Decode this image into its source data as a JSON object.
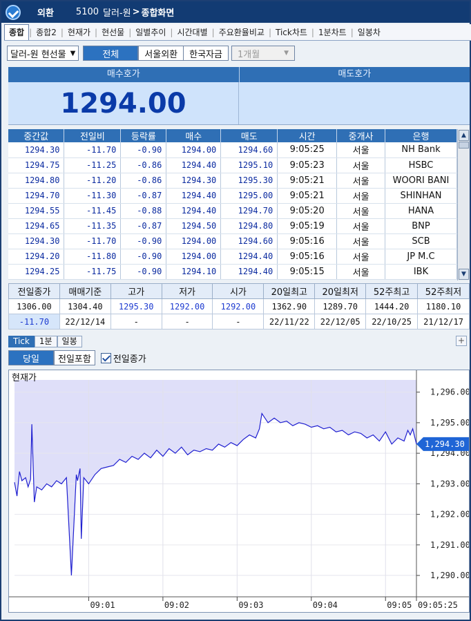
{
  "window": {
    "badge": "외환",
    "code": "5100",
    "name_prefix": "달러-원",
    "name_suffix": "종합화면"
  },
  "top_tabs": [
    "종합",
    "종합2",
    "현재가",
    "현선물",
    "일별추이",
    "시간대별",
    "주요환율비교",
    "Tick차트",
    "1분차트",
    "일봉차"
  ],
  "toolbar": {
    "instrument": "달러-원 현선물",
    "filters": [
      "전체",
      "서울외환",
      "한국자금"
    ],
    "period": "1개월"
  },
  "quote": {
    "bid_label": "매수호가",
    "ask_label": "매도호가",
    "bid_value": "1294.00",
    "ask_value": ""
  },
  "ticks": {
    "headers": [
      "중간값",
      "전일비",
      "등락률",
      "매수",
      "매도",
      "시간",
      "중개사",
      "은행"
    ],
    "rows": [
      [
        "1294.30",
        "-11.70",
        "-0.90",
        "1294.00",
        "1294.60",
        "9:05:25",
        "서울",
        "NH Bank"
      ],
      [
        "1294.75",
        "-11.25",
        "-0.86",
        "1294.40",
        "1295.10",
        "9:05:23",
        "서울",
        "HSBC"
      ],
      [
        "1294.80",
        "-11.20",
        "-0.86",
        "1294.30",
        "1295.30",
        "9:05:21",
        "서울",
        "WOORI BANI"
      ],
      [
        "1294.70",
        "-11.30",
        "-0.87",
        "1294.40",
        "1295.00",
        "9:05:21",
        "서울",
        "SHINHAN"
      ],
      [
        "1294.55",
        "-11.45",
        "-0.88",
        "1294.40",
        "1294.70",
        "9:05:20",
        "서울",
        "HANA"
      ],
      [
        "1294.65",
        "-11.35",
        "-0.87",
        "1294.50",
        "1294.80",
        "9:05:19",
        "서울",
        "BNP"
      ],
      [
        "1294.30",
        "-11.70",
        "-0.90",
        "1294.00",
        "1294.60",
        "9:05:16",
        "서울",
        "SCB"
      ],
      [
        "1294.20",
        "-11.80",
        "-0.90",
        "1294.00",
        "1294.40",
        "9:05:16",
        "서울",
        "JP M.C"
      ],
      [
        "1294.25",
        "-11.75",
        "-0.90",
        "1294.10",
        "1294.40",
        "9:05:15",
        "서울",
        "IBK"
      ]
    ]
  },
  "summary": {
    "headers": [
      "전일종가",
      "매매기준",
      "고가",
      "저가",
      "시가",
      "20일최고",
      "20일최저",
      "52주최고",
      "52주최저"
    ],
    "row1": [
      "1306.00",
      "1304.40",
      "1295.30",
      "1292.00",
      "1292.00",
      "1362.90",
      "1289.70",
      "1444.20",
      "1180.10"
    ],
    "row2": [
      "-11.70",
      "22/12/14",
      "-",
      "-",
      "-",
      "22/11/22",
      "22/12/05",
      "22/10/25",
      "21/12/17"
    ]
  },
  "chart_tabs": [
    "Tick",
    "1분",
    "일봉"
  ],
  "chart_controls": {
    "today": "당일",
    "include_prev": "전일포함",
    "prev_close_checkbox": "전일종가"
  },
  "chart_data": {
    "type": "line",
    "title": "현재가",
    "y_ticks": [
      "1,296.00",
      "1,295.00",
      "1,294.00",
      "1,293.00",
      "1,292.00",
      "1,291.00",
      "1,290.00"
    ],
    "y_tick_values": [
      1296,
      1295,
      1294,
      1293,
      1292,
      1291,
      1290
    ],
    "ylim": [
      1289.3,
      1296.4
    ],
    "x_ticks": [
      "09:01",
      "09:02",
      "09:03",
      "09:04",
      "09:05",
      "09:05:25"
    ],
    "x_tick_values": [
      60,
      120,
      180,
      240,
      300,
      325
    ],
    "xlim": [
      0,
      325
    ],
    "current_value": "1,294.30",
    "series": [
      {
        "x": [
          0,
          2,
          4,
          6,
          9,
          11,
          13,
          14,
          16,
          18,
          22,
          26,
          30,
          34,
          38,
          42,
          46,
          50,
          51,
          53,
          54,
          56,
          60,
          65,
          70,
          75,
          80,
          85,
          90,
          95,
          100,
          105,
          110,
          115,
          120,
          125,
          130,
          135,
          140,
          145,
          150,
          155,
          160,
          165,
          170,
          175,
          180,
          185,
          190,
          195,
          198,
          200,
          205,
          210,
          215,
          220,
          225,
          230,
          235,
          240,
          245,
          250,
          255,
          260,
          265,
          270,
          275,
          280,
          285,
          290,
          295,
          300,
          305,
          310,
          315,
          318,
          320,
          322,
          325
        ],
        "y": [
          1293.05,
          1292.6,
          1293.4,
          1293.1,
          1293.2,
          1292.9,
          1293.15,
          1294.95,
          1292.4,
          1292.9,
          1292.8,
          1293.0,
          1292.9,
          1293.1,
          1293.0,
          1293.2,
          1290.0,
          1293.3,
          1293.1,
          1293.5,
          1291.2,
          1293.2,
          1293.0,
          1293.3,
          1293.5,
          1293.55,
          1293.6,
          1293.8,
          1293.7,
          1293.9,
          1293.8,
          1294.0,
          1293.85,
          1294.1,
          1293.9,
          1294.15,
          1294.0,
          1294.2,
          1293.95,
          1294.1,
          1294.05,
          1294.15,
          1294.1,
          1294.3,
          1294.2,
          1294.35,
          1294.25,
          1294.45,
          1294.6,
          1294.5,
          1294.8,
          1295.3,
          1295.0,
          1295.15,
          1295.0,
          1295.05,
          1294.9,
          1295.0,
          1294.95,
          1294.85,
          1294.9,
          1294.8,
          1294.85,
          1294.7,
          1294.75,
          1294.6,
          1294.7,
          1294.65,
          1294.5,
          1294.6,
          1294.4,
          1294.7,
          1294.3,
          1294.5,
          1294.4,
          1294.75,
          1294.6,
          1294.8,
          1294.3
        ]
      }
    ]
  },
  "colors": {
    "header_blue": "#2f6fb5",
    "bid_bg": "#cfe3fb",
    "bid_text": "#0a3aa8",
    "line": "#1f1fd0",
    "area": "#dcdcf8",
    "badge": "#1f65d6"
  }
}
